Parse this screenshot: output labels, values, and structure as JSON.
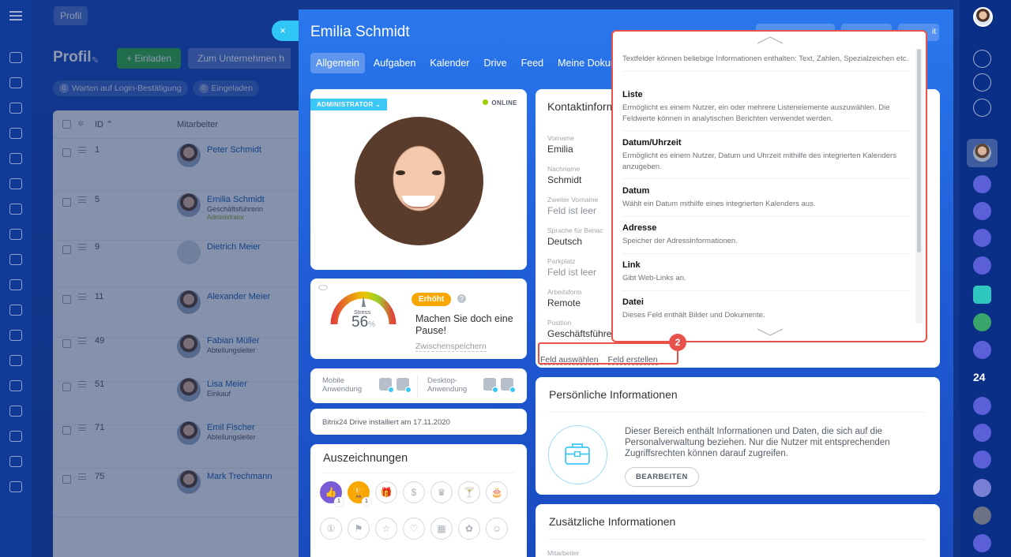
{
  "background": {
    "top_button": "Profil",
    "title": "Profil",
    "invite_button": "+ Einladen",
    "company_button": "Zum Unternehmen h",
    "filters": [
      {
        "count": "0",
        "label": "Warten auf Login-Bestätigung"
      },
      {
        "count": "0",
        "label": "Eingeladen"
      }
    ],
    "table_headers": {
      "id": "ID",
      "employee": "Mitarbeiter"
    },
    "rows": [
      {
        "id": "1",
        "name": "Peter Schmidt",
        "position": "",
        "role": ""
      },
      {
        "id": "5",
        "name": "Emilia Schmidt",
        "position": "Geschäftsführerin",
        "role": "Administrator"
      },
      {
        "id": "9",
        "name": "Dietrich Meier",
        "position": "",
        "role": ""
      },
      {
        "id": "11",
        "name": "Alexander Meier",
        "position": "",
        "role": ""
      },
      {
        "id": "49",
        "name": "Fabian Müller",
        "position": "Abteilungsleiter",
        "role": ""
      },
      {
        "id": "51",
        "name": "Lisa Meier",
        "position": "Einkauf",
        "role": ""
      },
      {
        "id": "71",
        "name": "Emil Fischer",
        "position": "Abteilungsleiter",
        "role": ""
      },
      {
        "id": "75",
        "name": "Mark Trechmann",
        "position": "",
        "role": ""
      }
    ]
  },
  "profile": {
    "close": "×",
    "name": "Emilia Schmidt",
    "tabs": [
      "Allgemein",
      "Aufgaben",
      "Kalender",
      "Drive",
      "Feed",
      "Meine Dokumer"
    ],
    "top_button_text": "it",
    "role_badge": "ADMINISTRATOR",
    "status": "ONLINE",
    "stress": {
      "label": "Stress",
      "value": "56",
      "unit": "%",
      "level": 0.56,
      "badge": "Erhöht",
      "help": "?",
      "message": "Machen Sie doch eine Pause!",
      "save": "Zwischenspeichern"
    },
    "apps": {
      "mobile": "Mobile Anwendung",
      "desktop": "Desktop-Anwendung"
    },
    "drive_info": "Bitrix24 Drive installiert am 17.11.2020",
    "awards": {
      "title": "Auszeichnungen",
      "row1": [
        {
          "icon": "thumbs-up-icon",
          "glyph": "👍",
          "count": "1",
          "style": "purple"
        },
        {
          "icon": "trophy-icon",
          "glyph": "🏆",
          "count": "1",
          "style": "orange"
        },
        {
          "icon": "gift-icon",
          "glyph": "🎁",
          "count": "",
          "style": ""
        },
        {
          "icon": "money-bag-icon",
          "glyph": "$",
          "count": "",
          "style": ""
        },
        {
          "icon": "crown-icon",
          "glyph": "♛",
          "count": "",
          "style": ""
        },
        {
          "icon": "cocktail-icon",
          "glyph": "🍸",
          "count": "",
          "style": ""
        },
        {
          "icon": "cake-icon",
          "glyph": "🎂",
          "count": "",
          "style": ""
        }
      ],
      "row2": [
        {
          "icon": "number-one-icon",
          "glyph": "①",
          "count": "",
          "style": ""
        },
        {
          "icon": "flag-icon",
          "glyph": "⚑",
          "count": "",
          "style": ""
        },
        {
          "icon": "star-icon",
          "glyph": "☆",
          "count": "",
          "style": ""
        },
        {
          "icon": "heart-icon",
          "glyph": "♡",
          "count": "",
          "style": ""
        },
        {
          "icon": "calendar-icon",
          "glyph": "▦",
          "count": "",
          "style": ""
        },
        {
          "icon": "medal-icon",
          "glyph": "✿",
          "count": "",
          "style": ""
        },
        {
          "icon": "smiley-icon",
          "glyph": "☺",
          "count": "",
          "style": ""
        }
      ]
    },
    "contact": {
      "title": "Kontaktinform",
      "fields": [
        {
          "label": "Vorname",
          "value": "Emilia"
        },
        {
          "label": "Nachname",
          "value": "Schmidt"
        },
        {
          "label": "Zweiter Vorname",
          "value": "Feld ist leer"
        },
        {
          "label": "Sprache für Benac",
          "value": "Deutsch"
        },
        {
          "label": "Parkplatz",
          "value": "Feld ist leer"
        },
        {
          "label": "Arbeitsform",
          "value": "Remote"
        },
        {
          "label": "Position",
          "value": "Geschäftsführe"
        }
      ],
      "select_field": "Feld auswählen",
      "create_field": "Feld erstellen"
    },
    "personal": {
      "title": "Persönliche Informationen",
      "description": "Dieser Bereich enthält Informationen und Daten, die sich auf die Personalverwaltung beziehen. Nur die Nutzer mit entsprechenden Zugriffsrechten können darauf zugreifen.",
      "edit_button": "BEARBEITEN"
    },
    "additional": {
      "title": "Zusätzliche Informationen",
      "field_label": "Mitarbeiter"
    }
  },
  "dropdown": {
    "intro": "Textfelder können beliebige Informationen enthalten: Text, Zahlen, Spezialzeichen etc.",
    "items": [
      {
        "title": "Liste",
        "desc": "Ermöglicht es einem Nutzer, ein oder mehrere Listenelemente auszuwählen. Die Feldwerte können in analytischen Berichten verwendet werden."
      },
      {
        "title": "Datum/Uhrzeit",
        "desc": "Ermöglicht es einem Nutzer, Datum und Uhrzeit mithilfe des integrierten Kalenders anzugeben."
      },
      {
        "title": "Datum",
        "desc": "Wählt ein Datum mithilfe eines integrierten Kalenders aus."
      },
      {
        "title": "Adresse",
        "desc": "Speicher der Adressinformationen."
      },
      {
        "title": "Link",
        "desc": "Gibt Web-Links an."
      },
      {
        "title": "Datei",
        "desc": "Dieses Feld enthält Bilder und Dokumente."
      }
    ]
  },
  "annotation": {
    "step": "2"
  },
  "right_sidebar": {
    "counter": "24"
  },
  "colors": {
    "accent_red": "#e8524a",
    "badge_blue": "#3bc8f5",
    "stress_orange": "#f7a700",
    "online_green": "#9dcf00"
  }
}
